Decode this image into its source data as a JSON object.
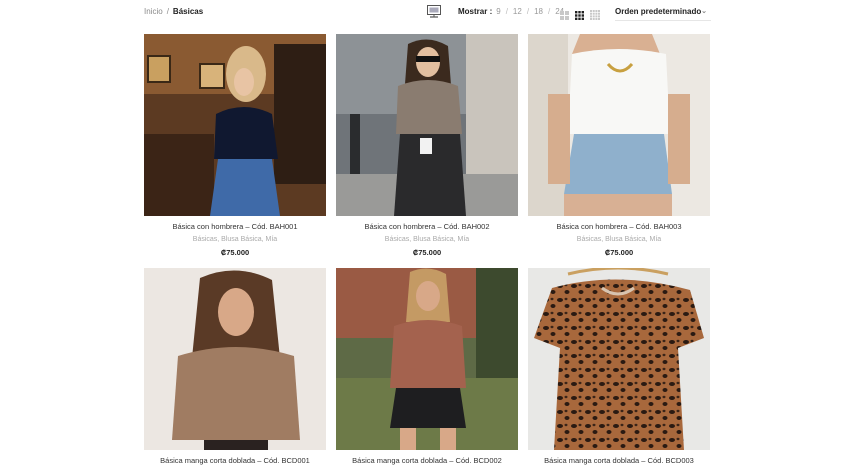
{
  "breadcrumb": {
    "home": "Inicio",
    "separator": "/",
    "current": "Básicas"
  },
  "filter_icon": "filter-panel-icon",
  "show": {
    "label": "Mostrar :",
    "options": [
      "9",
      "12",
      "18",
      "24"
    ],
    "separator": "/"
  },
  "view_icons": [
    "grid-2-icon",
    "grid-3-icon",
    "grid-4-icon"
  ],
  "sort": {
    "selected": "Orden predeterminado"
  },
  "colors": {
    "accent": "#222222",
    "muted": "#999999"
  },
  "products": [
    {
      "title": "Básica con hombrera – Cód. BAH001",
      "categories": "Básicas, Blusa Básica, Mía",
      "price": "₡75.000"
    },
    {
      "title": "Básica con hombrera – Cód. BAH002",
      "categories": "Básicas, Blusa Básica, Mía",
      "price": "₡75.000"
    },
    {
      "title": "Básica con hombrera – Cód. BAH003",
      "categories": "Básicas, Blusa Básica, Mía",
      "price": "₡75.000"
    },
    {
      "title": "Básica manga corta doblada – Cód. BCD001"
    },
    {
      "title": "Básica manga corta doblada – Cód. BCD002"
    },
    {
      "title": "Básica manga corta doblada – Cód. BCD003"
    }
  ]
}
